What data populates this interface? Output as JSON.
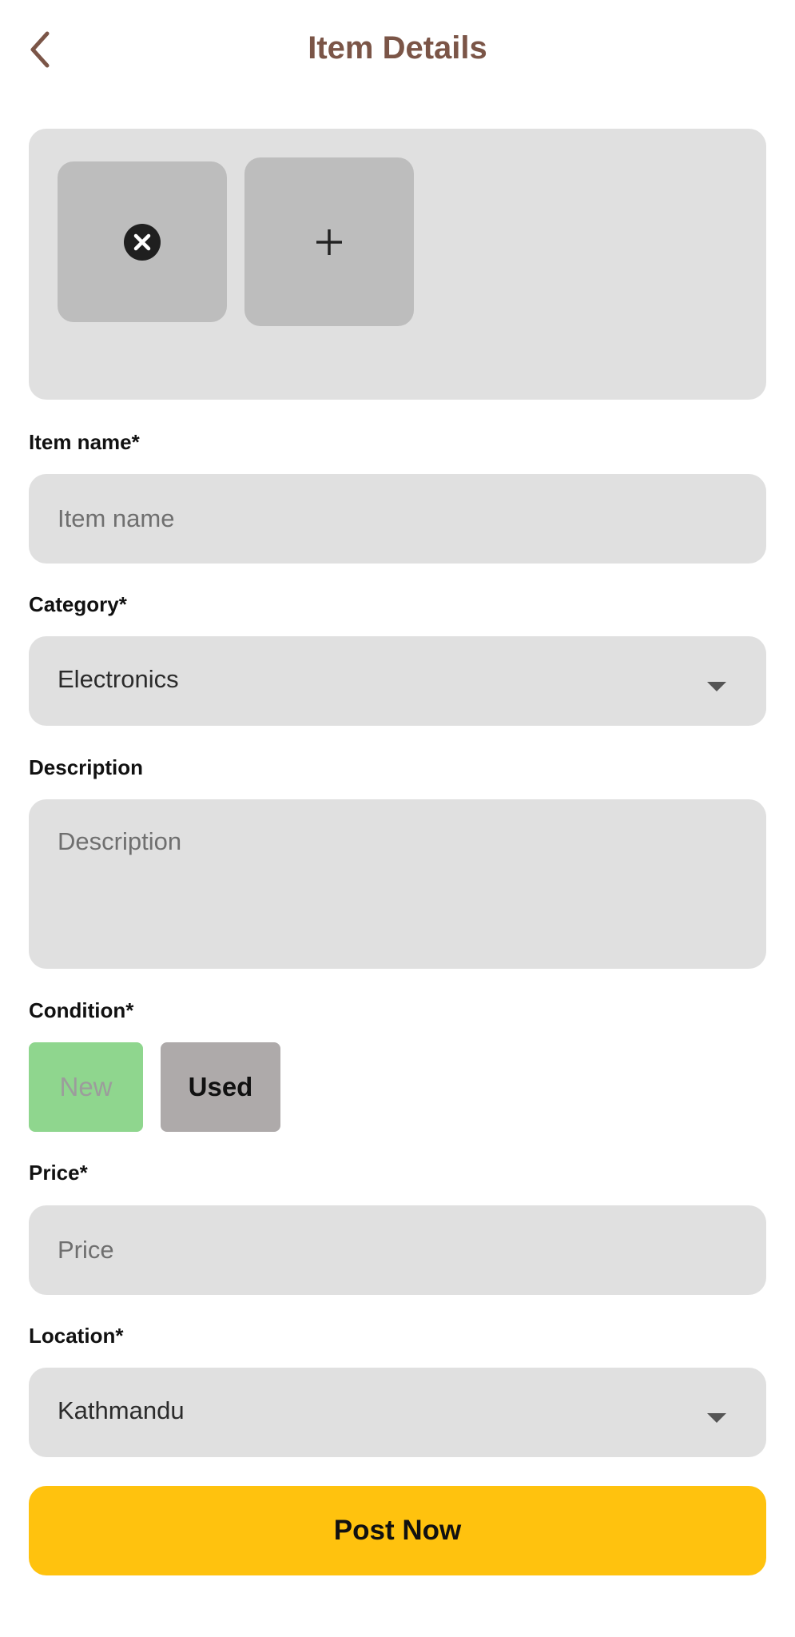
{
  "header": {
    "title": "Item Details",
    "back_icon": "chevron-left-icon"
  },
  "photos": {
    "remove_icon": "close-circle-icon",
    "add_icon": "plus-icon"
  },
  "form": {
    "item_name": {
      "label": "Item name*",
      "placeholder": "Item name",
      "value": ""
    },
    "category": {
      "label": "Category*",
      "value": "Electronics"
    },
    "description": {
      "label": "Description",
      "placeholder": "Description",
      "value": ""
    },
    "condition": {
      "label": "Condition*",
      "options": [
        "New",
        "Used"
      ],
      "selected": "Used"
    },
    "price": {
      "label": "Price*",
      "placeholder": "Price",
      "value": ""
    },
    "location": {
      "label": "Location*",
      "value": "Kathmandu"
    }
  },
  "submit": {
    "label": "Post Now"
  },
  "colors": {
    "title": "#7b5547",
    "field_bg": "#e0e0e0",
    "new_button": "#8fd68e",
    "used_button": "#aeaaaa",
    "post_button": "#ffc20e"
  }
}
